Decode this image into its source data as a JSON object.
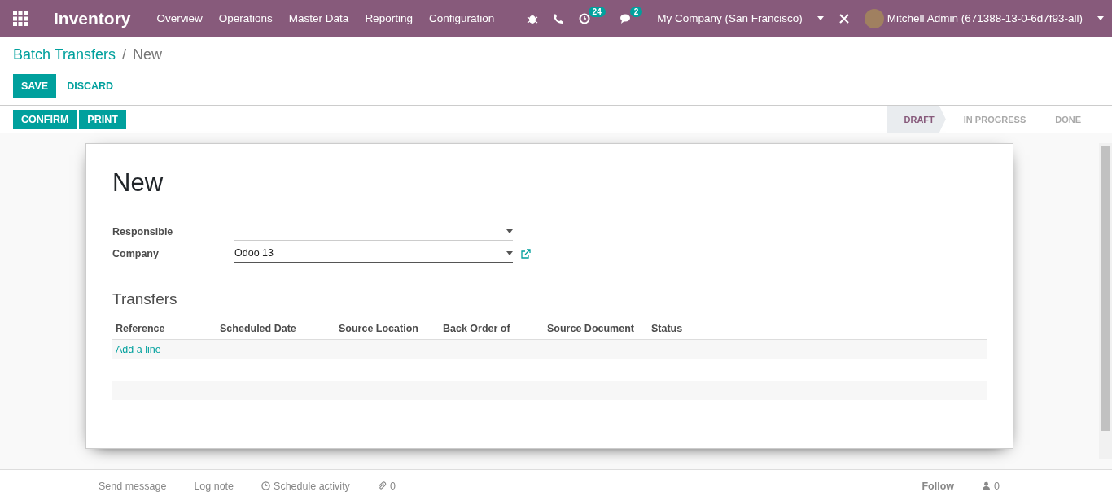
{
  "navbar": {
    "app_name": "Inventory",
    "menu": [
      "Overview",
      "Operations",
      "Master Data",
      "Reporting",
      "Configuration"
    ],
    "activity_count": "24",
    "message_count": "2",
    "company": "My Company (San Francisco)",
    "user": "Mitchell Admin (671388-13-0-6d7f93-all)"
  },
  "breadcrumb": {
    "parent": "Batch Transfers",
    "separator": "/",
    "current": "New"
  },
  "buttons": [
    {
      "label": "SAVE",
      "kind": "primary"
    },
    {
      "label": "DISCARD",
      "kind": "link"
    }
  ],
  "actions": [
    "CONFIRM",
    "PRINT"
  ],
  "stages": [
    {
      "label": "DRAFT",
      "selected": true
    },
    {
      "label": "IN PROGRESS",
      "selected": false
    },
    {
      "label": "DONE",
      "selected": false
    }
  ],
  "form": {
    "title": "New",
    "fields": [
      {
        "label": "Responsible",
        "external_link": false
      },
      {
        "label": "Company",
        "value": "Odoo 13",
        "external_link": true
      }
    ],
    "section_title": "Transfers",
    "columns": [
      "Reference",
      "Scheduled Date",
      "Source Location",
      "Back Order of",
      "Source Document",
      "Status"
    ],
    "add_line": "Add a line"
  },
  "chatter": {
    "send_message": "Send message",
    "log_note": "Log note",
    "schedule_activity": "Schedule activity",
    "attachments": "0",
    "follow": "Follow",
    "followers": "0"
  }
}
